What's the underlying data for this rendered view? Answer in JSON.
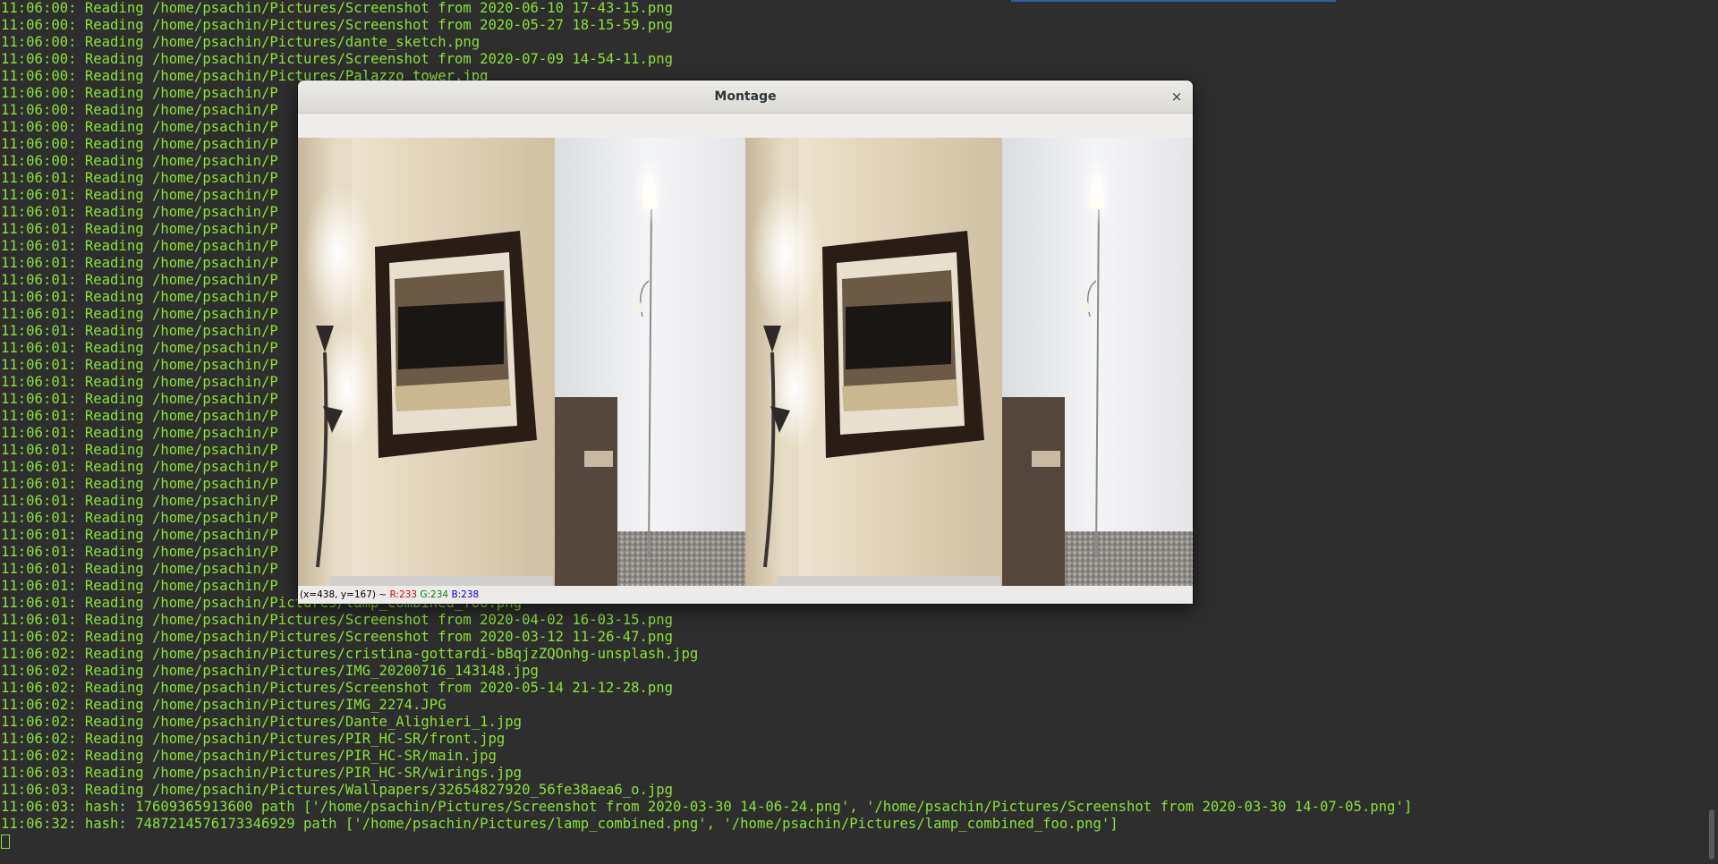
{
  "terminal": {
    "lines": [
      "11:06:00: Reading /home/psachin/Pictures/Screenshot from 2020-06-10 17-43-15.png",
      "11:06:00: Reading /home/psachin/Pictures/Screenshot from 2020-05-27 18-15-59.png",
      "11:06:00: Reading /home/psachin/Pictures/dante_sketch.png",
      "11:06:00: Reading /home/psachin/Pictures/Screenshot from 2020-07-09 14-54-11.png",
      "11:06:00: Reading /home/psachin/Pictures/Palazzo_tower.jpg",
      "11:06:00: Reading /home/psachin/P",
      "11:06:00: Reading /home/psachin/P",
      "11:06:00: Reading /home/psachin/P",
      "11:06:00: Reading /home/psachin/P",
      "11:06:00: Reading /home/psachin/P",
      "11:06:01: Reading /home/psachin/P",
      "11:06:01: Reading /home/psachin/P",
      "11:06:01: Reading /home/psachin/P",
      "11:06:01: Reading /home/psachin/P",
      "11:06:01: Reading /home/psachin/P",
      "11:06:01: Reading /home/psachin/P",
      "11:06:01: Reading /home/psachin/P",
      "11:06:01: Reading /home/psachin/P",
      "11:06:01: Reading /home/psachin/P",
      "11:06:01: Reading /home/psachin/P",
      "11:06:01: Reading /home/psachin/P",
      "11:06:01: Reading /home/psachin/P",
      "11:06:01: Reading /home/psachin/P",
      "11:06:01: Reading /home/psachin/P",
      "11:06:01: Reading /home/psachin/P",
      "11:06:01: Reading /home/psachin/P",
      "11:06:01: Reading /home/psachin/P",
      "11:06:01: Reading /home/psachin/P",
      "11:06:01: Reading /home/psachin/P",
      "11:06:01: Reading /home/psachin/P",
      "11:06:01: Reading /home/psachin/P",
      "11:06:01: Reading /home/psachin/P",
      "11:06:01: Reading /home/psachin/P",
      "11:06:01: Reading /home/psachin/P",
      "11:06:01: Reading /home/psachin/P",
      "11:06:01: Reading /home/psachin/Pictures/lamp_combined_foo.png",
      "11:06:01: Reading /home/psachin/Pictures/Screenshot from 2020-04-02 16-03-15.png",
      "11:06:02: Reading /home/psachin/Pictures/Screenshot from 2020-03-12 11-26-47.png",
      "11:06:02: Reading /home/psachin/Pictures/cristina-gottardi-bBqjzZQOnhg-unsplash.jpg",
      "11:06:02: Reading /home/psachin/Pictures/IMG_20200716_143148.jpg",
      "11:06:02: Reading /home/psachin/Pictures/Screenshot from 2020-05-14 21-12-28.png",
      "11:06:02: Reading /home/psachin/Pictures/IMG_2274.JPG",
      "11:06:02: Reading /home/psachin/Pictures/Dante_Alighieri_1.jpg",
      "11:06:02: Reading /home/psachin/Pictures/PIR_HC-SR/front.jpg",
      "11:06:02: Reading /home/psachin/Pictures/PIR_HC-SR/main.jpg",
      "11:06:03: Reading /home/psachin/Pictures/PIR_HC-SR/wirings.jpg",
      "11:06:03: Reading /home/psachin/Pictures/Wallpapers/32654827920_56fe38aea6_o.jpg",
      "11:06:03: hash: 17609365913600 path ['/home/psachin/Pictures/Screenshot from 2020-03-30 14-06-24.png', '/home/psachin/Pictures/Screenshot from 2020-03-30 14-07-05.png']",
      "11:06:32: hash: 7487214576173346929 path ['/home/psachin/Pictures/lamp_combined.png', '/home/psachin/Pictures/lamp_combined_foo.png']"
    ],
    "text_color": "#8ae234",
    "background": "#2e2e2e"
  },
  "montage_window": {
    "title": "Montage",
    "close_label": "×",
    "status": {
      "coords": "(x=438, y=167) ~",
      "r": "R:233",
      "g": "G:234",
      "b": "B:238"
    }
  }
}
